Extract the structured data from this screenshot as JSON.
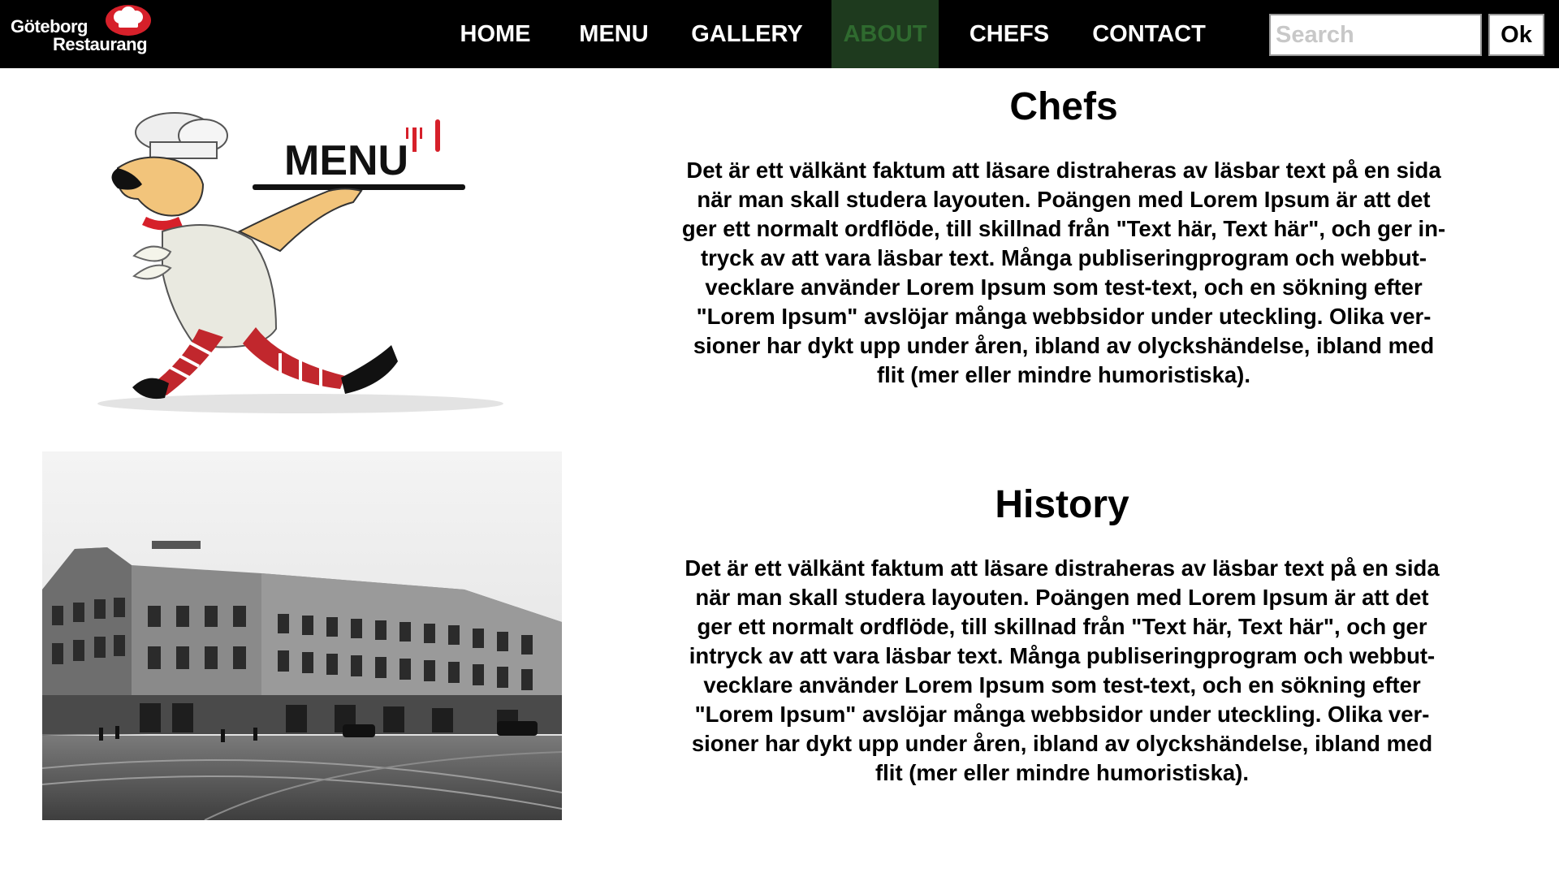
{
  "logo": {
    "line1": "Göteborg",
    "line2": "Restaurang"
  },
  "nav": {
    "items": [
      {
        "label": "HOME"
      },
      {
        "label": "MENU"
      },
      {
        "label": "GALLERY"
      },
      {
        "label": "ABOUT"
      },
      {
        "label": "CHEFS"
      },
      {
        "label": "CONTACT"
      }
    ],
    "active": "ABOUT"
  },
  "search": {
    "placeholder": "Search",
    "value": "",
    "button_label": "Ok"
  },
  "chefs": {
    "title": "Chefs",
    "image_text": "MENU",
    "text": "Det är ett välkänt faktum att läsare distraheras av läsbar text på en sida när man skall studera layouten. Poängen med Lorem Ipsum är att det ger ett normalt ordflöde, till skillnad från \"Text här, Text här\", och ger intryck av att vara läsbar text. Många publiseringprogram och webbutvecklare använder Lorem Ipsum som test-text, och en sökning efter \"Lorem Ipsum\" avslöjar många webbsidor under uteckling. Olika versioner har dykt upp under åren, ibland av olyckshändelse, ibland med flit (mer eller mindre humoristiska).",
    "lines": [
      "Det är ett välkänt faktum att läsare distraheras av läsbar text på en sida",
      "när man skall studera layouten. Poängen med Lorem Ipsum är att det",
      "ger ett normalt ordflöde, till skillnad från \"Text här, Text här\", och ger in-",
      "tryck av att vara läsbar text. Många publiseringprogram och webbut-",
      "vecklare använder Lorem Ipsum som test-text, och en sökning efter",
      "\"Lorem Ipsum\" avslöjar många webbsidor under uteckling. Olika ver-",
      "sioner har dykt upp under åren, ibland av olyckshändelse, ibland med",
      "flit (mer eller mindre humoristiska)."
    ]
  },
  "history": {
    "title": "History",
    "lines": [
      "Det är ett välkänt faktum att läsare distraheras av läsbar text på en sida",
      "när man skall studera layouten. Poängen med Lorem Ipsum är att det",
      "ger ett normalt ordflöde, till skillnad från \"Text här, Text här\", och ger",
      "intryck av att vara läsbar text. Många publiseringprogram och webbut-",
      "vecklare använder Lorem Ipsum som test-text, och en sökning efter",
      "\"Lorem Ipsum\" avslöjar många webbsidor under uteckling. Olika ver-",
      "sioner har dykt upp under åren, ibland av olyckshändelse, ibland med",
      "flit (mer eller mindre humoristiska)."
    ]
  },
  "colors": {
    "navbar_bg": "#000000",
    "active_bg": "#1e3a1e",
    "active_text": "#2f6a2f",
    "accent_red": "#d6202a"
  }
}
